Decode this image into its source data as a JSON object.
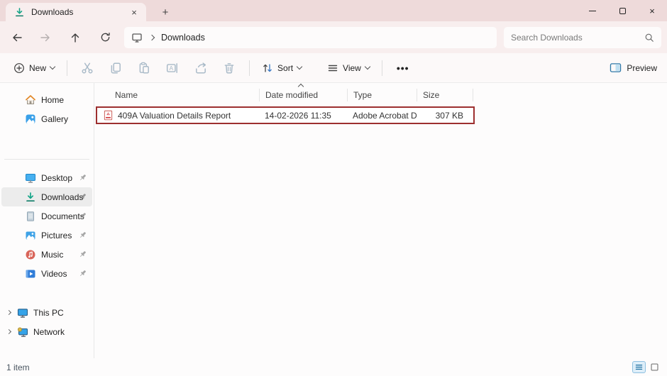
{
  "titlebar": {
    "tab_label": "Downloads"
  },
  "icons": {
    "close": "×",
    "plus": "+",
    "more": "•••"
  },
  "navbar": {
    "breadcrumb": "Downloads",
    "search_placeholder": "Search Downloads"
  },
  "toolbar": {
    "new": "New",
    "sort": "Sort",
    "view": "View",
    "preview": "Preview"
  },
  "list": {
    "columns": [
      {
        "label": "Name"
      },
      {
        "label": "Date modified"
      },
      {
        "label": "Type"
      },
      {
        "label": "Size"
      }
    ],
    "files": [
      {
        "name": "409A Valuation Details Report",
        "date_modified": "14-02-2026 11:35",
        "type": "Adobe Acrobat D…",
        "size": "307 KB"
      }
    ]
  },
  "sidebar": {
    "top": [
      {
        "label": "Home"
      },
      {
        "label": "Gallery"
      }
    ],
    "quick_access": [
      {
        "label": "Desktop"
      },
      {
        "label": "Downloads"
      },
      {
        "label": "Documents"
      },
      {
        "label": "Pictures"
      },
      {
        "label": "Music"
      },
      {
        "label": "Videos"
      }
    ],
    "tree": [
      {
        "label": "This PC"
      },
      {
        "label": "Network"
      }
    ]
  },
  "statusbar": {
    "count": "1 item"
  },
  "colors": {
    "titlebar": "#eedada",
    "tab": "#f8eeee",
    "toolbar": "#fcf9f9",
    "selection_border": "#9d2f2f",
    "accent_blue": "#1c6ea0",
    "download_teal": "#17a689",
    "pdf_red": "#d13438"
  }
}
